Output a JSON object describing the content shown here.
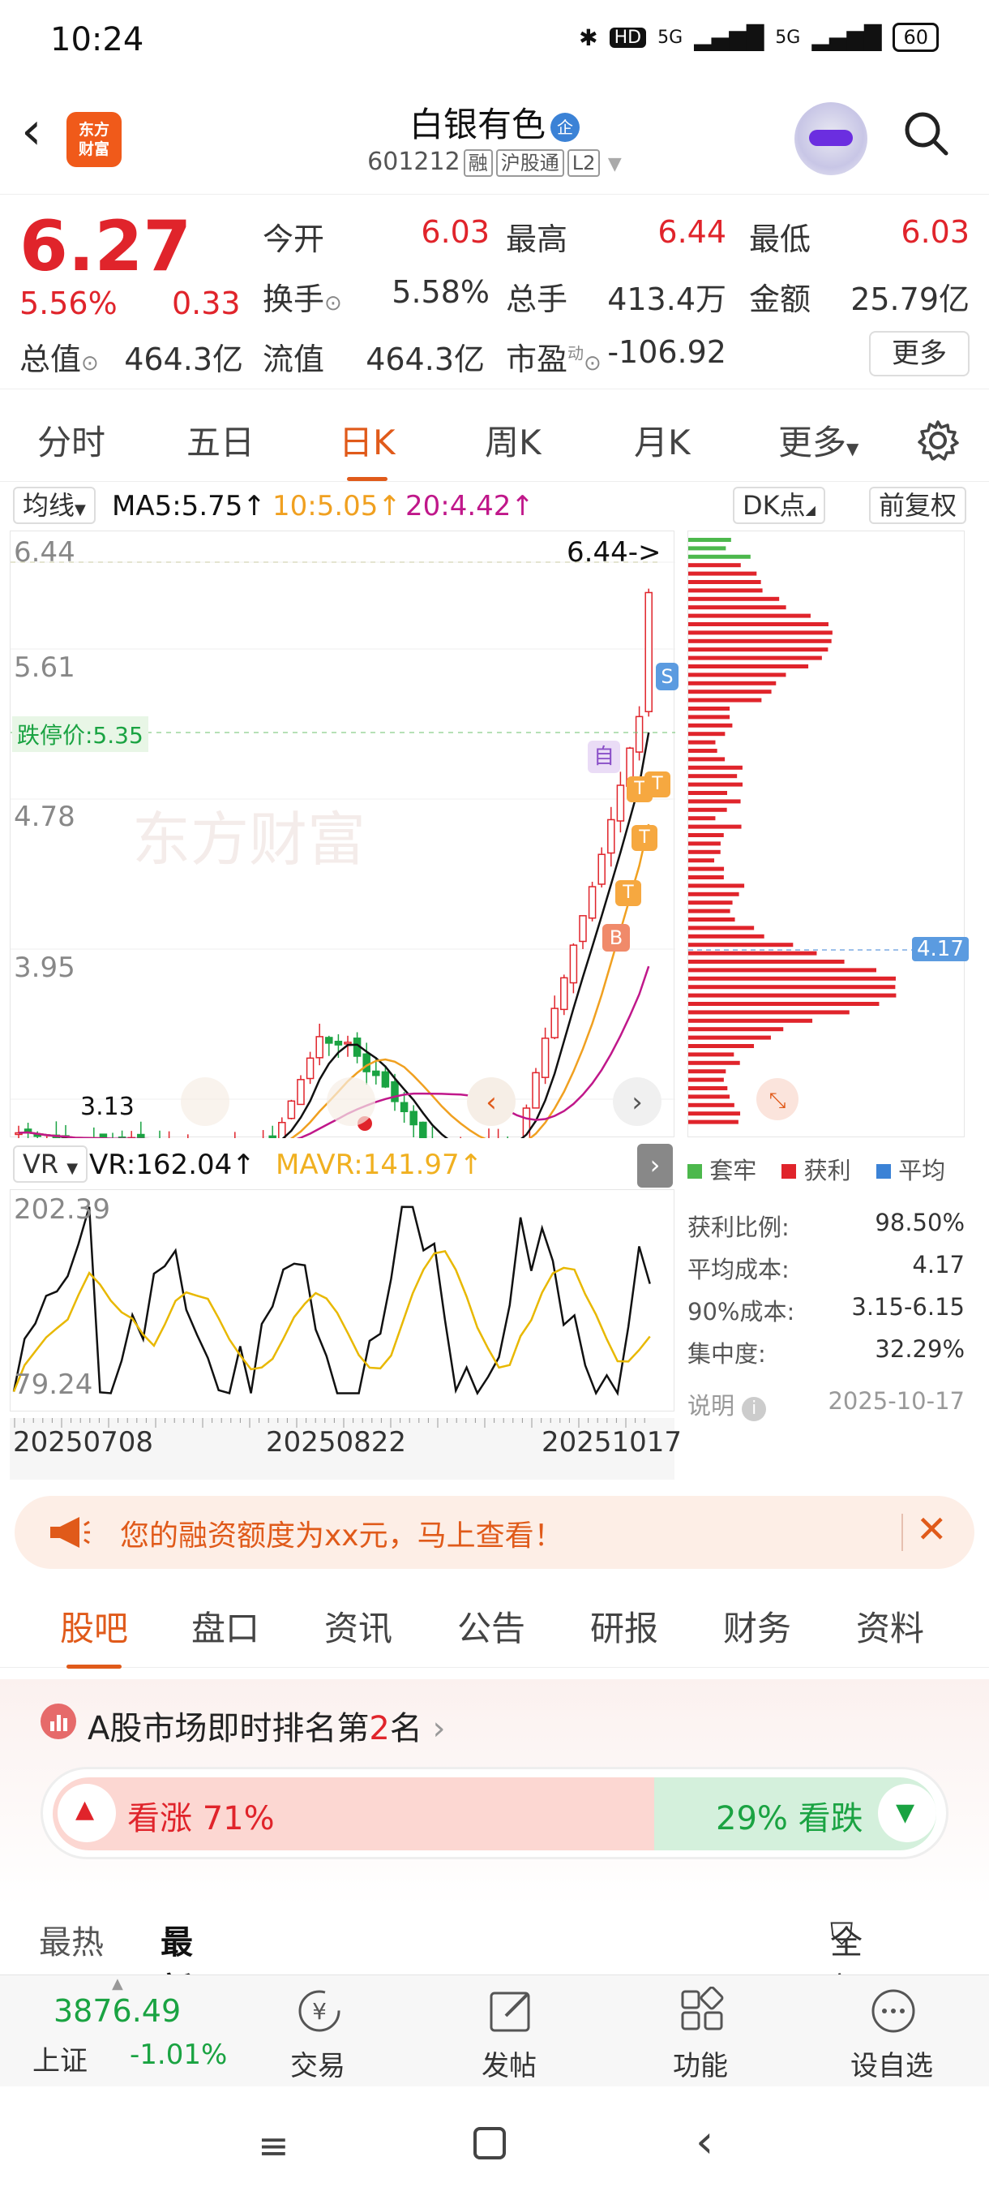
{
  "status": {
    "time": "10:24",
    "network": "5G",
    "battery": "60"
  },
  "header": {
    "logo_line1": "东方",
    "logo_line2": "财富",
    "name": "白银有色",
    "badge": "企",
    "code": "601212",
    "tags": [
      "融",
      "沪股通",
      "L2"
    ]
  },
  "quote": {
    "price": "6.27",
    "change_pct": "5.56%",
    "change": "0.33",
    "open_label": "今开",
    "open": "6.03",
    "high_label": "最高",
    "high": "6.44",
    "low_label": "最低",
    "low": "6.03",
    "turnover_label": "换手",
    "turnover": "5.58%",
    "volume_label": "总手",
    "volume": "413.4万",
    "amount_label": "金额",
    "amount": "25.79亿",
    "mcap_label": "总值",
    "mcap": "464.3亿",
    "float_label": "流值",
    "float": "464.3亿",
    "pe_label": "市盈",
    "pe_sup": "动",
    "pe": "-106.92",
    "more": "更多"
  },
  "period_tabs": [
    "分时",
    "五日",
    "日K",
    "周K",
    "月K",
    "更多"
  ],
  "active_period": "日K",
  "ma_legend": {
    "selector": "均线",
    "ma5": "MA5:5.75",
    "ma10": "10:5.05",
    "ma20": "20:4.42",
    "dk": "DK点",
    "adjust": "前复权",
    "colors": {
      "ma5": "#111111",
      "ma10": "#f0a020",
      "ma20": "#c0178a"
    }
  },
  "kchart": {
    "y_labels": [
      "6.44",
      "5.61",
      "4.78",
      "3.95"
    ],
    "high_marker": "6.44->",
    "limit_label": "跌停价:5.35",
    "low_marker": "3.13",
    "markers": {
      "buy": "B",
      "sell": "S",
      "t": "T",
      "auto": "自"
    }
  },
  "distribution": {
    "avg_label": "4.17",
    "legend": [
      "套牢",
      "获利",
      "平均"
    ],
    "legend_colors": [
      "#4cb84c",
      "#e0242b",
      "#3b82d6"
    ]
  },
  "stats": [
    {
      "label": "获利比例:",
      "value": "98.50%"
    },
    {
      "label": "平均成本:",
      "value": "4.17"
    },
    {
      "label": "90%成本:",
      "value": "3.15-6.15"
    },
    {
      "label": "集中度:",
      "value": "32.29%"
    }
  ],
  "stats_note": {
    "label": "说明",
    "date": "2025-10-17"
  },
  "vr": {
    "selector": "VR",
    "vr": "VR:162.04",
    "mavr": "MAVR:141.97",
    "ymax": "202.39",
    "ymin": "79.24"
  },
  "dates": [
    "20250708",
    "20250822",
    "20251017"
  ],
  "banner": {
    "text": "您的融资额度为xx元，马上查看！"
  },
  "content_tabs": [
    "股吧",
    "盘口",
    "资讯",
    "公告",
    "研报",
    "财务",
    "资料"
  ],
  "active_content": "股吧",
  "rank": {
    "prefix": "A股市场即时排名第",
    "num": "2",
    "suffix": "名"
  },
  "sentiment": {
    "bull_label": "看涨 71%",
    "bear_label": "29% 看跌",
    "bull": 0.71,
    "bear": 0.29
  },
  "sort": {
    "hot": "最热",
    "new": "最新",
    "filter": "全部"
  },
  "bottom_nav": {
    "index_value": "3876.49",
    "index_name": "上证",
    "index_change": "-1.01%",
    "items": [
      "交易",
      "发帖",
      "功能",
      "设自选"
    ]
  }
}
